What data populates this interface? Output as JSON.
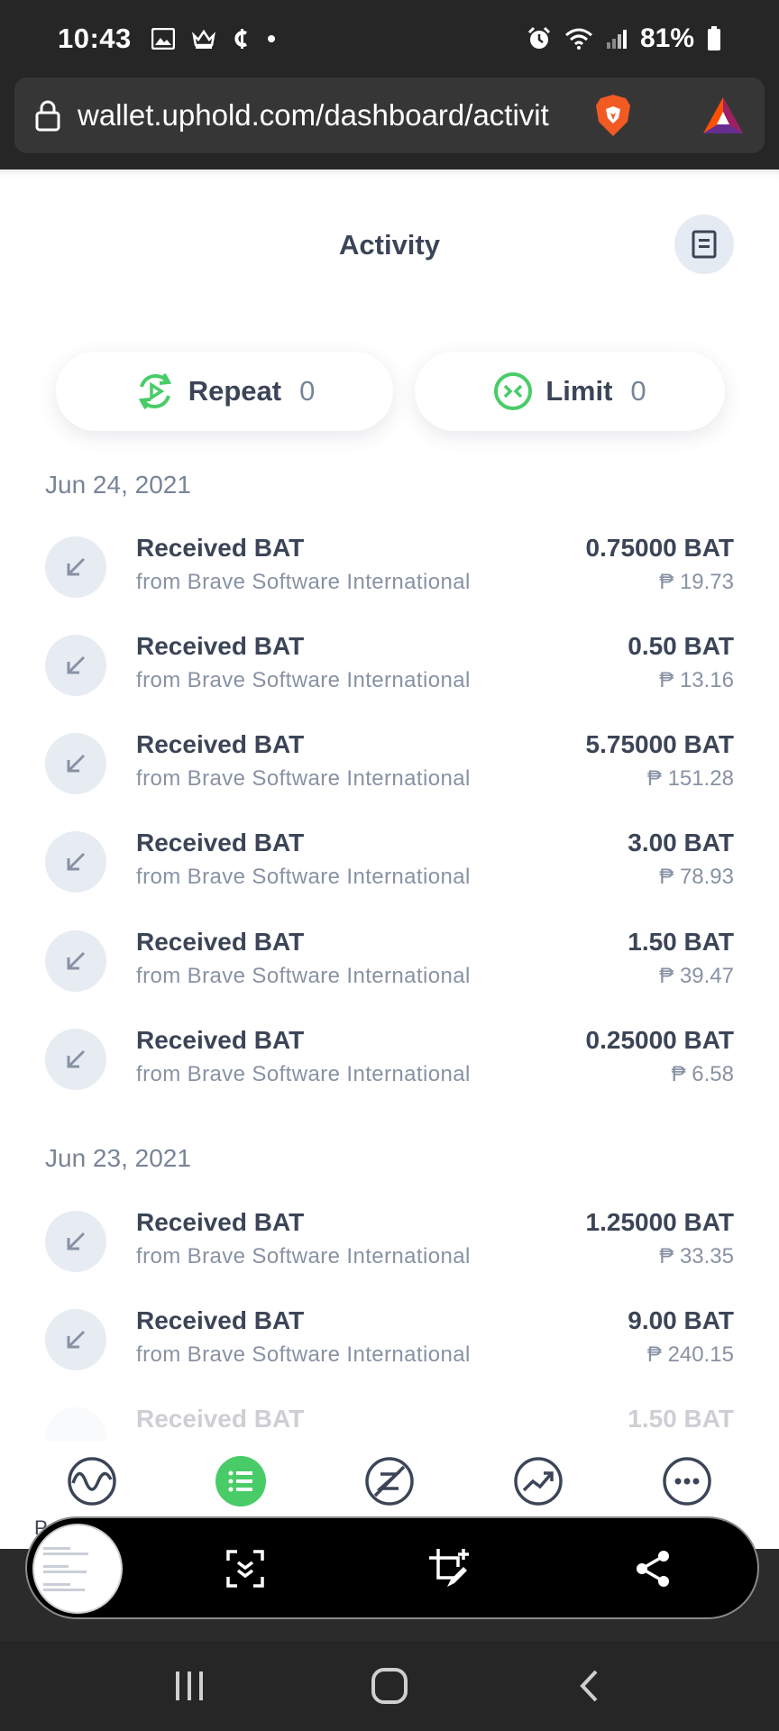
{
  "status_bar": {
    "time": "10:43",
    "battery": "81%",
    "icons": [
      "gallery-icon",
      "crown-icon",
      "cent-icon",
      "dot-icon",
      "alarm-icon",
      "wifi-icon",
      "signal-icon",
      "battery-icon"
    ]
  },
  "browser": {
    "url": "wallet.uphold.com/dashboard/activit"
  },
  "header": {
    "title": "Activity"
  },
  "filters": {
    "repeat_label": "Repeat",
    "repeat_count": "0",
    "limit_label": "Limit",
    "limit_count": "0"
  },
  "groups": [
    {
      "date": "Jun 24, 2021",
      "transactions": [
        {
          "title": "Received BAT",
          "subtitle": "from Brave Software International",
          "amount": "0.75000 BAT",
          "fiat": "₱ 19.73"
        },
        {
          "title": "Received BAT",
          "subtitle": "from Brave Software International",
          "amount": "0.50 BAT",
          "fiat": "₱ 13.16"
        },
        {
          "title": "Received BAT",
          "subtitle": "from Brave Software International",
          "amount": "5.75000 BAT",
          "fiat": "₱ 151.28"
        },
        {
          "title": "Received BAT",
          "subtitle": "from Brave Software International",
          "amount": "3.00 BAT",
          "fiat": "₱ 78.93"
        },
        {
          "title": "Received BAT",
          "subtitle": "from Brave Software International",
          "amount": "1.50 BAT",
          "fiat": "₱ 39.47"
        },
        {
          "title": "Received BAT",
          "subtitle": "from Brave Software International",
          "amount": "0.25000 BAT",
          "fiat": "₱ 6.58"
        }
      ]
    },
    {
      "date": "Jun 23, 2021",
      "transactions": [
        {
          "title": "Received BAT",
          "subtitle": "from Brave Software International",
          "amount": "1.25000 BAT",
          "fiat": "₱ 33.35"
        },
        {
          "title": "Received BAT",
          "subtitle": "from Brave Software International",
          "amount": "9.00 BAT",
          "fiat": "₱ 240.15"
        },
        {
          "title": "Received BAT",
          "subtitle": "",
          "amount": "1.50 BAT",
          "fiat": ""
        }
      ]
    }
  ],
  "bottom_nav": {
    "items": [
      "pulse-icon",
      "activity-list-icon",
      "exchange-icon",
      "trends-icon",
      "more-icon"
    ],
    "active": "activity-list-icon",
    "partial_label": "P"
  },
  "colors": {
    "accent_green": "#49cc68",
    "text_dark": "#3c4557",
    "text_muted": "#8892a4",
    "icon_circle": "#e7ecf3",
    "system_bar": "#262626"
  }
}
